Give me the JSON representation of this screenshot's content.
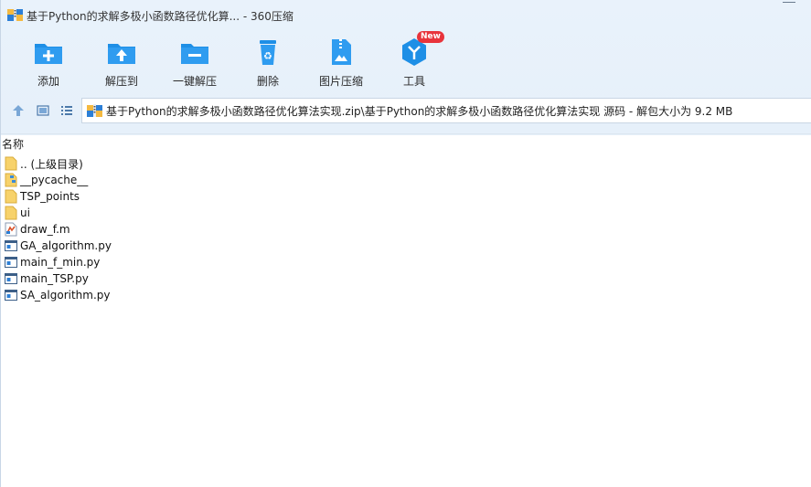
{
  "window": {
    "title": "基于Python的求解多极小函数路径优化算... - 360压缩"
  },
  "toolbar": {
    "buttons": [
      {
        "label": "添加",
        "icon": "add-folder-icon"
      },
      {
        "label": "解压到",
        "icon": "extract-to-icon"
      },
      {
        "label": "一键解压",
        "icon": "one-click-extract-icon"
      },
      {
        "label": "删除",
        "icon": "recycle-delete-icon"
      },
      {
        "label": "图片压缩",
        "icon": "image-compress-icon"
      },
      {
        "label": "工具",
        "icon": "tools-icon",
        "badge": "New"
      }
    ]
  },
  "nav": {
    "address": "基于Python的求解多极小函数路径优化算法实现.zip\\基于Python的求解多极小函数路径优化算法实现 源码 - 解包大小为 9.2 MB"
  },
  "list": {
    "column_name": "名称",
    "items": [
      {
        "name": ".. (上级目录)",
        "type": "folder"
      },
      {
        "name": "__pycache__",
        "type": "folder-special"
      },
      {
        "name": "TSP_points",
        "type": "folder"
      },
      {
        "name": "ui",
        "type": "folder"
      },
      {
        "name": "draw_f.m",
        "type": "matlab-file"
      },
      {
        "name": "GA_algorithm.py",
        "type": "py-file"
      },
      {
        "name": "main_f_min.py",
        "type": "py-file"
      },
      {
        "name": "main_TSP.py",
        "type": "py-file"
      },
      {
        "name": "SA_algorithm.py",
        "type": "py-file"
      }
    ]
  },
  "colors": {
    "accent": "#1e8fe6",
    "toolbar_bg": "#e8f1fb",
    "badge": "#e8343c",
    "folder": "#f7d26a"
  }
}
